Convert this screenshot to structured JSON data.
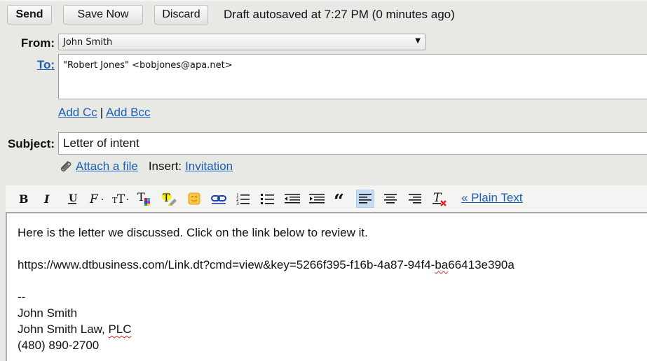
{
  "actions": {
    "send_label": "Send",
    "save_label": "Save Now",
    "discard_label": "Discard",
    "autosave_status": "Draft autosaved at 7:27 PM (0 minutes ago)"
  },
  "header": {
    "from_label": "From:",
    "from_value": "John Smith",
    "to_label": "To:",
    "to_value": "\"Robert Jones\" <bobjones@apa.net>",
    "add_cc": "Add Cc",
    "separator": "|",
    "add_bcc": "Add Bcc",
    "subject_label": "Subject:",
    "subject_value": "Letter of intent",
    "attach_label": "Attach a file",
    "insert_label": "Insert:",
    "insert_link": "Invitation"
  },
  "toolbar": {
    "items": [
      {
        "name": "bold",
        "icon": "bold-icon"
      },
      {
        "name": "italic",
        "icon": "italic-icon"
      },
      {
        "name": "underline",
        "icon": "underline-icon"
      },
      {
        "name": "font",
        "icon": "font-family-icon"
      },
      {
        "name": "size",
        "icon": "font-size-icon"
      },
      {
        "name": "text-color",
        "icon": "text-color-icon"
      },
      {
        "name": "highlight",
        "icon": "highlight-icon"
      },
      {
        "name": "emoticon",
        "icon": "emoticon-icon"
      },
      {
        "name": "link",
        "icon": "link-icon"
      },
      {
        "name": "numbered-list",
        "icon": "numbered-list-icon"
      },
      {
        "name": "bulleted-list",
        "icon": "bulleted-list-icon"
      },
      {
        "name": "outdent",
        "icon": "outdent-icon"
      },
      {
        "name": "indent",
        "icon": "indent-icon"
      },
      {
        "name": "quote",
        "icon": "quote-icon"
      },
      {
        "name": "align-left",
        "icon": "align-left-icon",
        "active": true
      },
      {
        "name": "align-center",
        "icon": "align-center-icon"
      },
      {
        "name": "align-right",
        "icon": "align-right-icon"
      },
      {
        "name": "remove-formatting",
        "icon": "remove-formatting-icon"
      }
    ],
    "plain_text_label": "« Plain Text",
    "active_color": "#c6dcf5"
  },
  "body": {
    "line1": "Here is the letter we discussed. Click on the link below to review it.",
    "url_before": "https://www.dtbusiness.com/Link.dt?cmd=view&key=5266f395-f16b-4a87-94f4-",
    "url_misspelled": "ba",
    "url_after": "66413e390a",
    "sig_dash": "--",
    "sig_name": "John Smith",
    "sig_company_before": "John Smith Law, ",
    "sig_company_misspelled": "PLC",
    "sig_phone": "(480) 890-2700"
  },
  "colors": {
    "link": "#1a5fb4",
    "background": "#e8e8e4",
    "spellcheck": "#d62020"
  }
}
